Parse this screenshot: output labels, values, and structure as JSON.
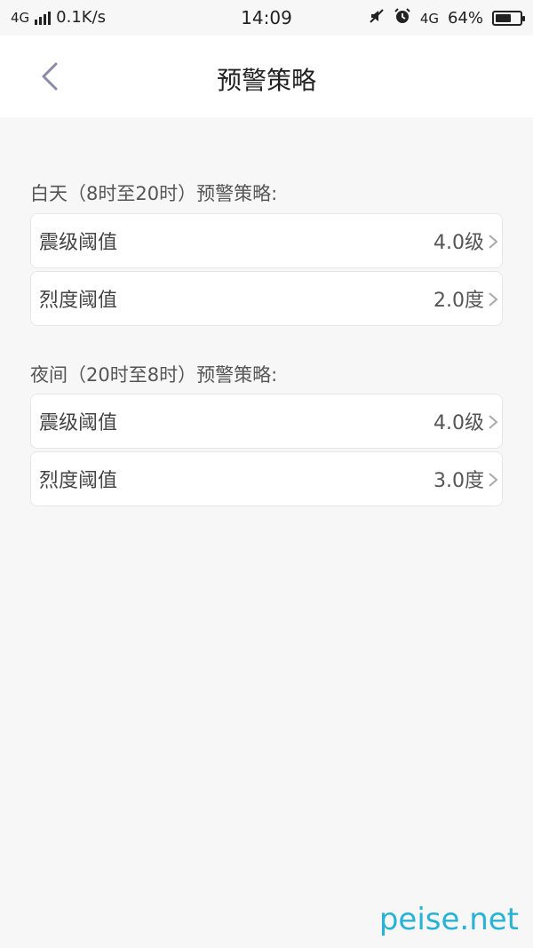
{
  "status_bar": {
    "network": "4G",
    "speed": "0.1K/s",
    "time": "14:09",
    "network_right": "4G",
    "battery_percent_text": "64%",
    "battery_level": 0.64
  },
  "header": {
    "title": "预警策略"
  },
  "sections": [
    {
      "label": "白天（8时至20时）预警策略:",
      "rows": [
        {
          "label": "震级阈值",
          "value": "4.0级"
        },
        {
          "label": "烈度阈值",
          "value": "2.0度"
        }
      ]
    },
    {
      "label": "夜间（20时至8时）预警策略:",
      "rows": [
        {
          "label": "震级阈值",
          "value": "4.0级"
        },
        {
          "label": "烈度阈值",
          "value": "3.0度"
        }
      ]
    }
  ],
  "watermark": "peise.net",
  "colors": {
    "background": "#f7f7f7",
    "back_arrow": "#8a8aa8",
    "watermark": "#27b3d6"
  }
}
